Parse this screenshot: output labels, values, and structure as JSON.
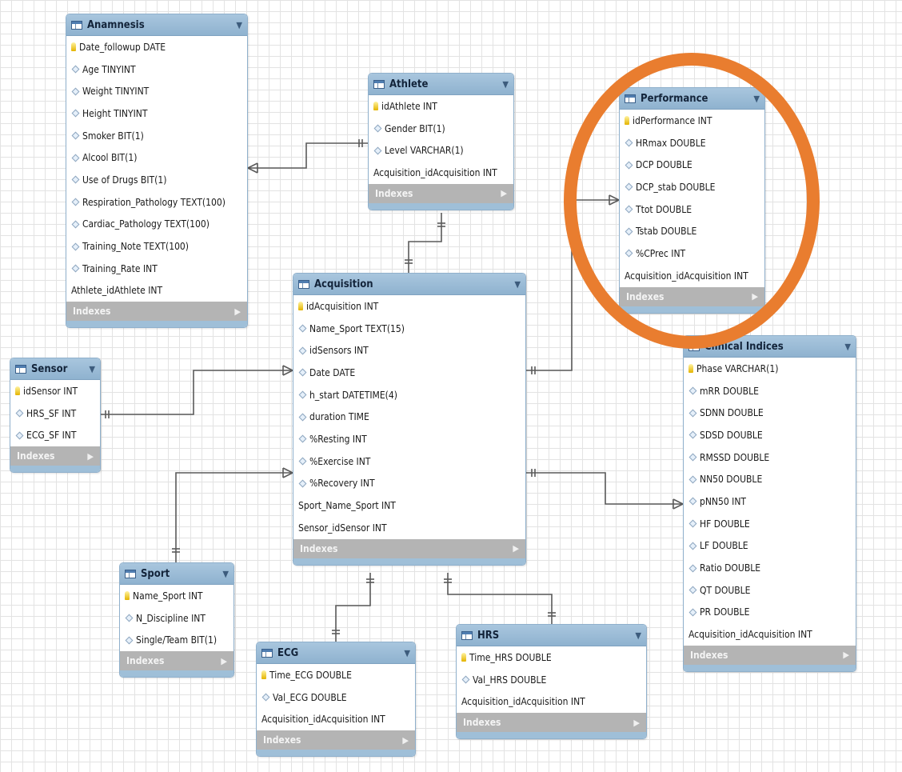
{
  "tables": {
    "anamnesis": {
      "name": "Anamnesis",
      "columns": [
        {
          "label": "Date_followup DATE",
          "icon": "key"
        },
        {
          "label": "Age TINYINT",
          "icon": "diamond"
        },
        {
          "label": "Weight TINYINT",
          "icon": "diamond"
        },
        {
          "label": "Height TINYINT",
          "icon": "diamond"
        },
        {
          "label": "Smoker BIT(1)",
          "icon": "diamond"
        },
        {
          "label": "Alcool BIT(1)",
          "icon": "diamond"
        },
        {
          "label": "Use of Drugs BIT(1)",
          "icon": "diamond"
        },
        {
          "label": "Respiration_Pathology TEXT(100)",
          "icon": "diamond"
        },
        {
          "label": "Cardiac_Pathology TEXT(100)",
          "icon": "diamond"
        },
        {
          "label": "Training_Note TEXT(100)",
          "icon": "diamond"
        },
        {
          "label": "Training_Rate INT",
          "icon": "diamond"
        },
        {
          "label": "Athlete_idAthlete INT",
          "icon": "none"
        }
      ],
      "indexes_label": "Indexes"
    },
    "athlete": {
      "name": "Athlete",
      "columns": [
        {
          "label": "idAthlete INT",
          "icon": "key"
        },
        {
          "label": "Gender BIT(1)",
          "icon": "diamond"
        },
        {
          "label": "Level VARCHAR(1)",
          "icon": "diamond"
        },
        {
          "label": "Acquisition_idAcquisition INT",
          "icon": "none"
        }
      ],
      "indexes_label": "Indexes"
    },
    "performance": {
      "name": "Performance",
      "columns": [
        {
          "label": "idPerformance INT",
          "icon": "key"
        },
        {
          "label": "HRmax DOUBLE",
          "icon": "diamond"
        },
        {
          "label": "DCP DOUBLE",
          "icon": "diamond"
        },
        {
          "label": "DCP_stab DOUBLE",
          "icon": "diamond"
        },
        {
          "label": "Ttot DOUBLE",
          "icon": "diamond"
        },
        {
          "label": "Tstab DOUBLE",
          "icon": "diamond"
        },
        {
          "label": "%CPrec INT",
          "icon": "diamond"
        },
        {
          "label": "Acquisition_idAcquisition INT",
          "icon": "none"
        }
      ],
      "indexes_label": "Indexes"
    },
    "acquisition": {
      "name": "Acquisition",
      "columns": [
        {
          "label": "idAcquisition INT",
          "icon": "key"
        },
        {
          "label": "Name_Sport TEXT(15)",
          "icon": "diamond"
        },
        {
          "label": "idSensors INT",
          "icon": "diamond"
        },
        {
          "label": "Date DATE",
          "icon": "diamond"
        },
        {
          "label": "h_start DATETIME(4)",
          "icon": "diamond"
        },
        {
          "label": "duration TIME",
          "icon": "diamond"
        },
        {
          "label": "%Resting INT",
          "icon": "diamond"
        },
        {
          "label": "%Exercise INT",
          "icon": "diamond"
        },
        {
          "label": "%Recovery INT",
          "icon": "diamond"
        },
        {
          "label": "Sport_Name_Sport INT",
          "icon": "none"
        },
        {
          "label": "Sensor_idSensor INT",
          "icon": "none"
        }
      ],
      "indexes_label": "Indexes"
    },
    "sensor": {
      "name": "Sensor",
      "columns": [
        {
          "label": "idSensor INT",
          "icon": "key"
        },
        {
          "label": "HRS_SF INT",
          "icon": "diamond"
        },
        {
          "label": "ECG_SF INT",
          "icon": "diamond"
        }
      ],
      "indexes_label": "Indexes"
    },
    "clinical": {
      "name": "Clinical Indices",
      "columns": [
        {
          "label": "Phase VARCHAR(1)",
          "icon": "key"
        },
        {
          "label": "mRR DOUBLE",
          "icon": "diamond"
        },
        {
          "label": "SDNN DOUBLE",
          "icon": "diamond"
        },
        {
          "label": "SDSD DOUBLE",
          "icon": "diamond"
        },
        {
          "label": "RMSSD DOUBLE",
          "icon": "diamond"
        },
        {
          "label": "NN50 DOUBLE",
          "icon": "diamond"
        },
        {
          "label": "pNN50 INT",
          "icon": "diamond"
        },
        {
          "label": "HF DOUBLE",
          "icon": "diamond"
        },
        {
          "label": "LF DOUBLE",
          "icon": "diamond"
        },
        {
          "label": "Ratio DOUBLE",
          "icon": "diamond"
        },
        {
          "label": "QT DOUBLE",
          "icon": "diamond"
        },
        {
          "label": "PR DOUBLE",
          "icon": "diamond"
        },
        {
          "label": "Acquisition_idAcquisition INT",
          "icon": "none"
        }
      ],
      "indexes_label": "Indexes"
    },
    "sport": {
      "name": "Sport",
      "columns": [
        {
          "label": "Name_Sport INT",
          "icon": "key"
        },
        {
          "label": "N_Discipline INT",
          "icon": "diamond"
        },
        {
          "label": "Single/Team BIT(1)",
          "icon": "diamond"
        }
      ],
      "indexes_label": "Indexes"
    },
    "ecg": {
      "name": "ECG",
      "columns": [
        {
          "label": "Time_ECG DOUBLE",
          "icon": "key"
        },
        {
          "label": "Val_ECG DOUBLE",
          "icon": "diamond"
        },
        {
          "label": "Acquisition_idAcquisition INT",
          "icon": "none"
        }
      ],
      "indexes_label": "Indexes"
    },
    "hrs": {
      "name": "HRS",
      "columns": [
        {
          "label": "Time_HRS DOUBLE",
          "icon": "key"
        },
        {
          "label": "Val_HRS DOUBLE",
          "icon": "diamond"
        },
        {
          "label": "Acquisition_idAcquisition INT",
          "icon": "none"
        }
      ],
      "indexes_label": "Indexes"
    }
  },
  "highlight_color": "#e97d2f",
  "header_color": "#9dbdd8",
  "indexes_bar_color": "#b4b4b4"
}
